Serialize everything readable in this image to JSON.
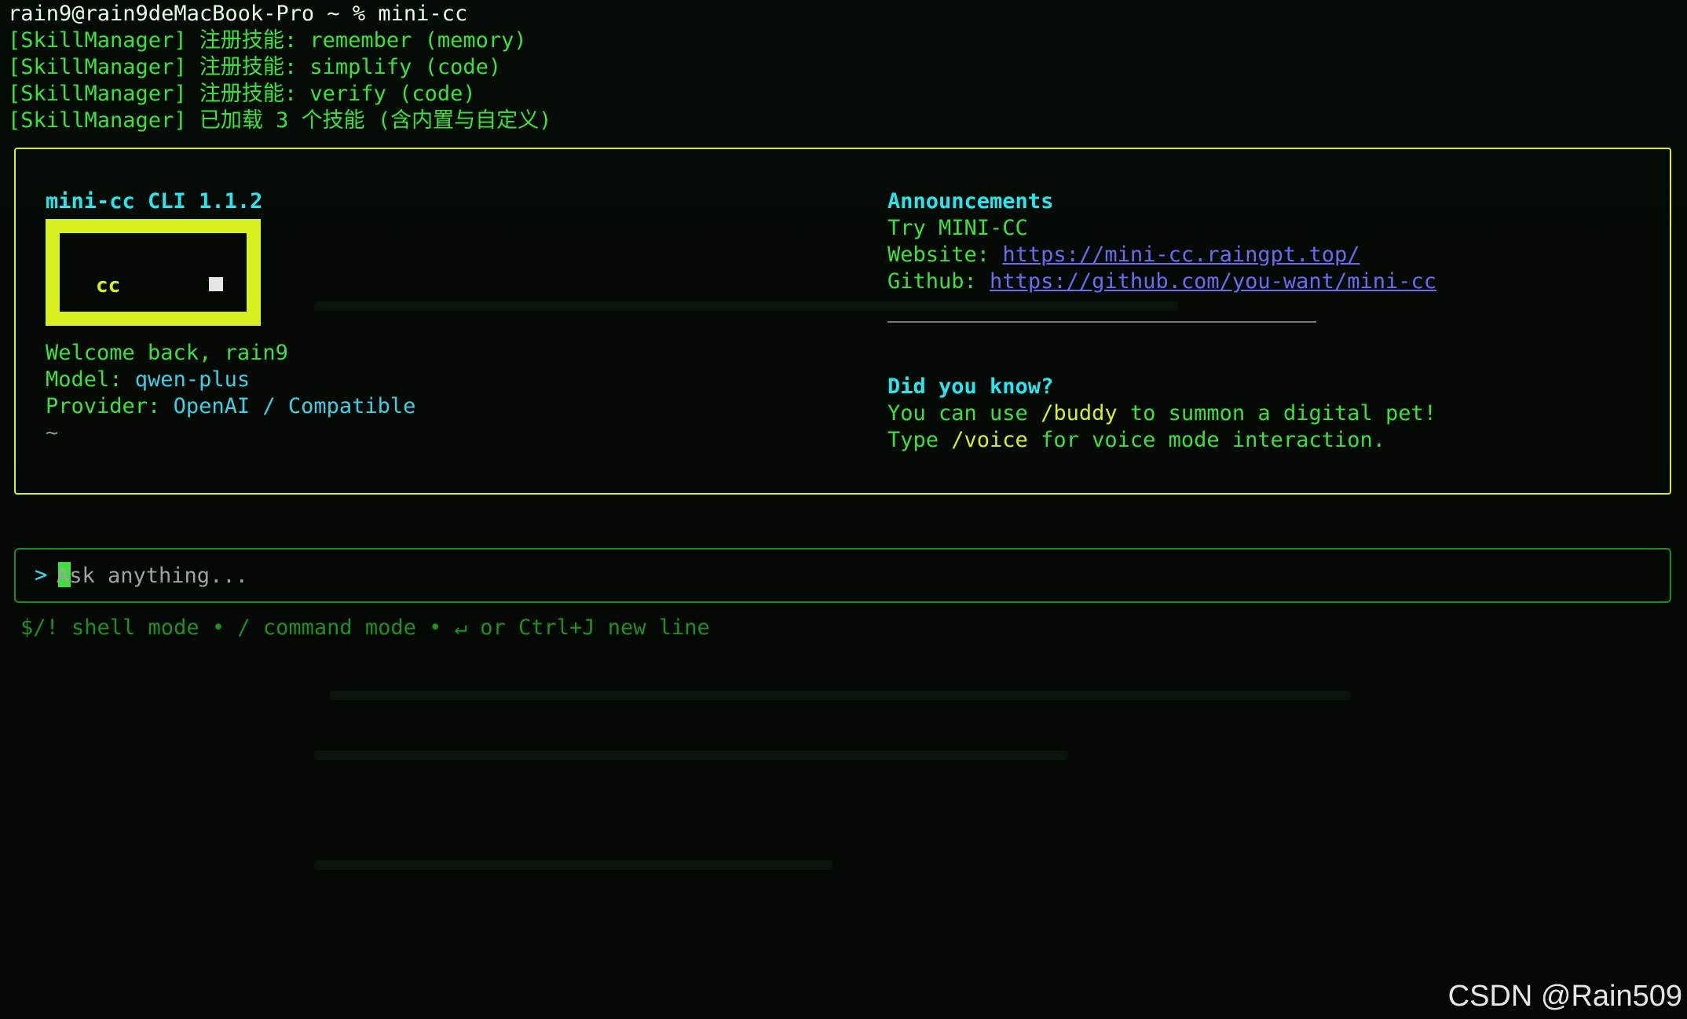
{
  "terminal": {
    "prompt": "rain9@rain9deMacBook-Pro ~ % mini-cc",
    "logs": [
      "[SkillManager] 注册技能: remember (memory)",
      "[SkillManager] 注册技能: simplify (code)",
      "[SkillManager] 注册技能: verify (code)",
      "[SkillManager] 已加载 3 个技能 (含内置与自定义)"
    ]
  },
  "panel": {
    "app_title": "mini-cc CLI 1.1.2",
    "logo_text": "cc",
    "welcome": "Welcome back, rain9",
    "model_label": "Model: ",
    "model_value": "qwen-plus",
    "provider_label": "Provider: ",
    "provider_value": "OpenAI / Compatible",
    "cwd": "~",
    "announcements": {
      "title": "Announcements",
      "line1": "Try MINI-CC",
      "website_label": "Website: ",
      "website_url": "https://mini-cc.raingpt.top/",
      "github_label": "Github: ",
      "github_url": "https://github.com/you-want/mini-cc"
    },
    "tips": {
      "title": "Did you know?",
      "tip1_a": "You can use ",
      "tip1_cmd": "/buddy",
      "tip1_b": " to summon a digital pet!",
      "tip2_a": "Type ",
      "tip2_cmd": "/voice",
      "tip2_b": " for voice mode interaction."
    }
  },
  "input": {
    "caret": ">",
    "placeholder": "Ask anything..."
  },
  "hint": "$/! shell mode • / command mode • ↵ or Ctrl+J new line",
  "watermark": "CSDN @Rain509",
  "colors": {
    "accent_yellow": "#d8f020",
    "text_green": "#3de03d",
    "title_cyan": "#27e6f0",
    "link_blue": "#6a6af6"
  }
}
